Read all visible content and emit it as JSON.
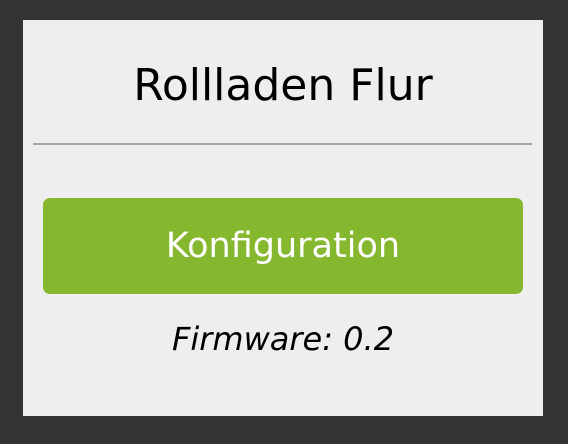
{
  "page": {
    "title": "Rollladen Flur",
    "config_button_label": "Konfiguration",
    "firmware_text": "Firmware: 0.2"
  },
  "colors": {
    "background": "#333333",
    "panel": "#eeeeee",
    "button": "#85b72f",
    "button_text": "#ffffff",
    "divider": "#a4a4a4"
  }
}
